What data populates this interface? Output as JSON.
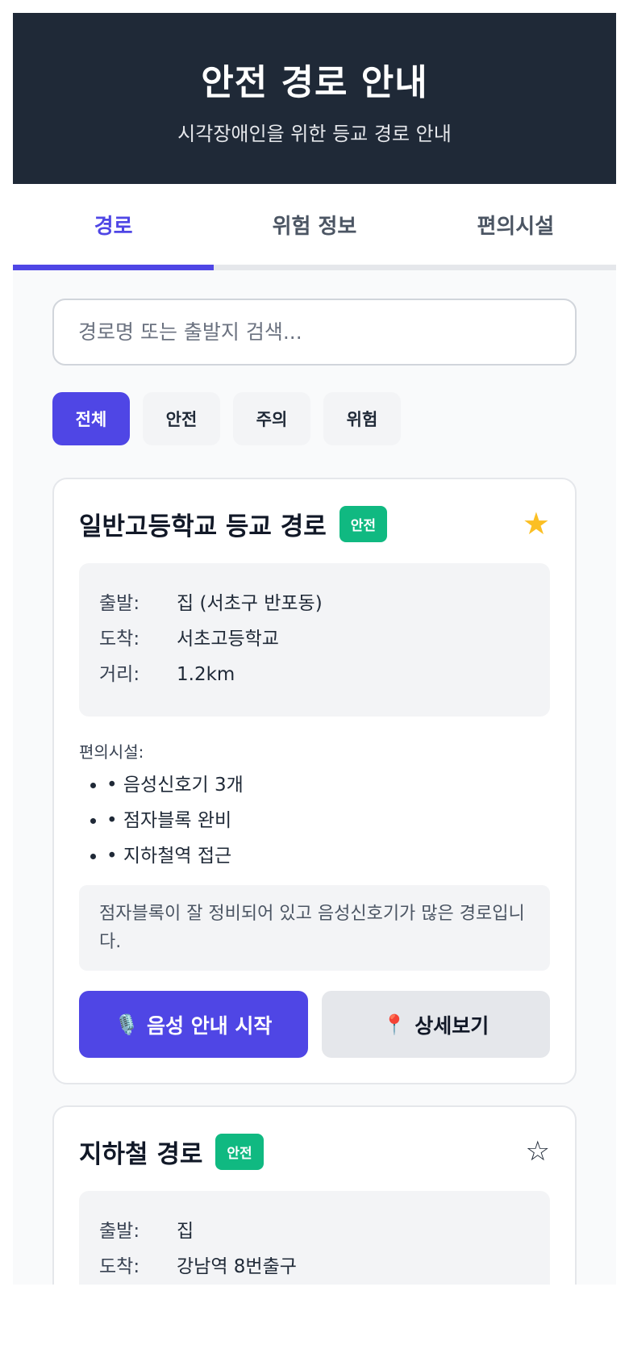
{
  "header": {
    "title": "안전 경로 안내",
    "subtitle": "시각장애인을 위한 등교 경로 안내"
  },
  "tabs": [
    {
      "label": "경로",
      "active": true
    },
    {
      "label": "위험 정보",
      "active": false
    },
    {
      "label": "편의시설",
      "active": false
    }
  ],
  "search": {
    "placeholder": "경로명 또는 출발지 검색...",
    "value": ""
  },
  "filters": [
    {
      "label": "전체",
      "active": true
    },
    {
      "label": "안전",
      "active": false
    },
    {
      "label": "주의",
      "active": false
    },
    {
      "label": "위험",
      "active": false
    }
  ],
  "routes": [
    {
      "title": "일반고등학교 등교 경로",
      "badge": "안전",
      "favorite": true,
      "star_icon": "star-filled-icon",
      "info": [
        {
          "label": "출발:",
          "value": "집 (서초구 반포동)"
        },
        {
          "label": "도착:",
          "value": "서초고등학교"
        },
        {
          "label": "거리:",
          "value": "1.2km"
        }
      ],
      "facilities_label": "편의시설:",
      "facilities": [
        "• 음성신호기 3개",
        "• 점자블록 완비",
        "• 지하철역 접근"
      ],
      "note": "점자블록이 잘 정비되어 있고 음성신호기가 많은 경로입니다.",
      "primary_button": {
        "icon": "🎙️",
        "label": "음성 안내 시작"
      },
      "secondary_button": {
        "icon": "📍",
        "label": "상세보기"
      }
    },
    {
      "title": "지하철 경로",
      "badge": "안전",
      "favorite": false,
      "star_icon": "star-outline-icon",
      "info": [
        {
          "label": "출발:",
          "value": "집"
        },
        {
          "label": "도착:",
          "value": "강남역 8번출구"
        }
      ]
    }
  ],
  "colors": {
    "header_bg": "#1f2937",
    "accent": "#4f46e5",
    "safe_badge": "#10b981",
    "star": "#fbbf24"
  }
}
